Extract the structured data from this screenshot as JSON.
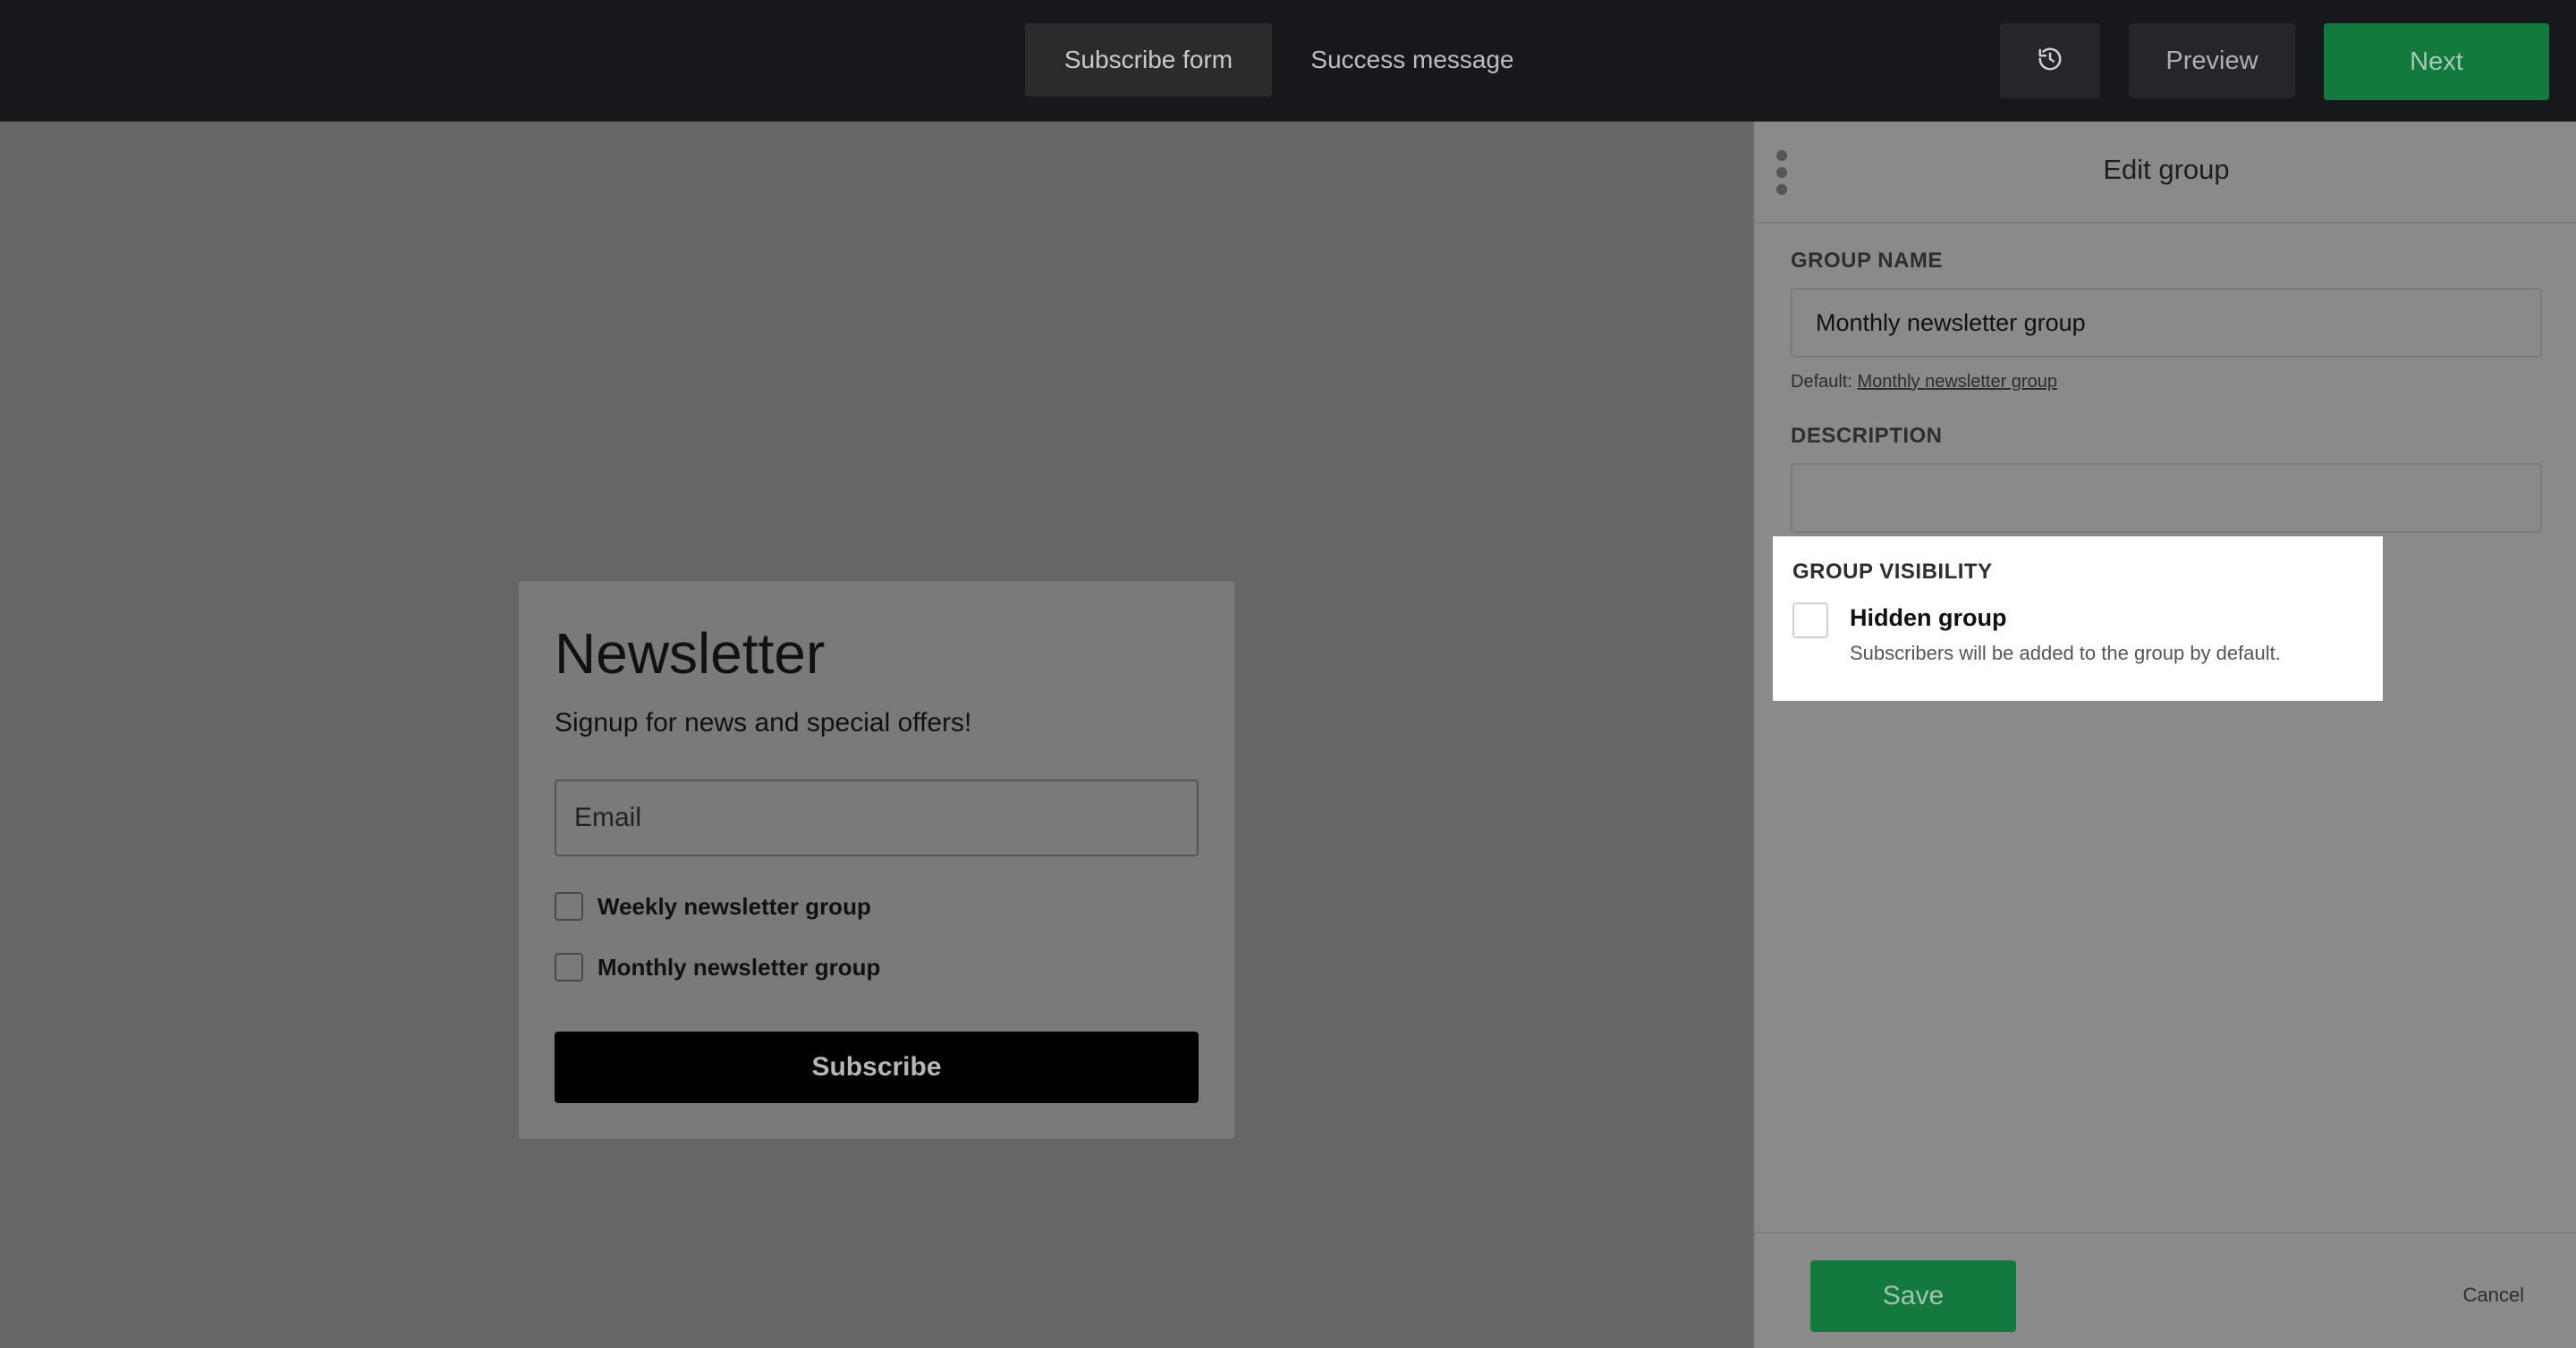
{
  "topbar": {
    "tabs": [
      {
        "label": "Subscribe form",
        "active": true
      },
      {
        "label": "Success message",
        "active": false
      }
    ],
    "history_icon": "history-icon",
    "preview_label": "Preview",
    "next_label": "Next"
  },
  "form": {
    "title": "Newsletter",
    "subtitle": "Signup for news and special offers!",
    "email_placeholder": "Email",
    "groups": [
      {
        "label": "Weekly newsletter group",
        "checked": false
      },
      {
        "label": "Monthly newsletter group",
        "checked": false
      }
    ],
    "subscribe_label": "Subscribe"
  },
  "panel": {
    "title": "Edit group",
    "menu_icon": "kebab-menu-icon",
    "group_name_label": "GROUP NAME",
    "group_name_value": "Monthly newsletter group",
    "default_prefix": "Default:",
    "default_value": "Monthly newsletter group",
    "description_label": "DESCRIPTION",
    "description_value": "",
    "visibility": {
      "title": "GROUP VISIBILITY",
      "checkbox_label": "Hidden group",
      "checked": false,
      "description": "Subscribers will be added to the group by default."
    },
    "save_label": "Save",
    "cancel_label": "Cancel"
  },
  "colors": {
    "accent_green": "#127a3c",
    "topbar_bg": "#16181b",
    "overlay": "#666666"
  }
}
